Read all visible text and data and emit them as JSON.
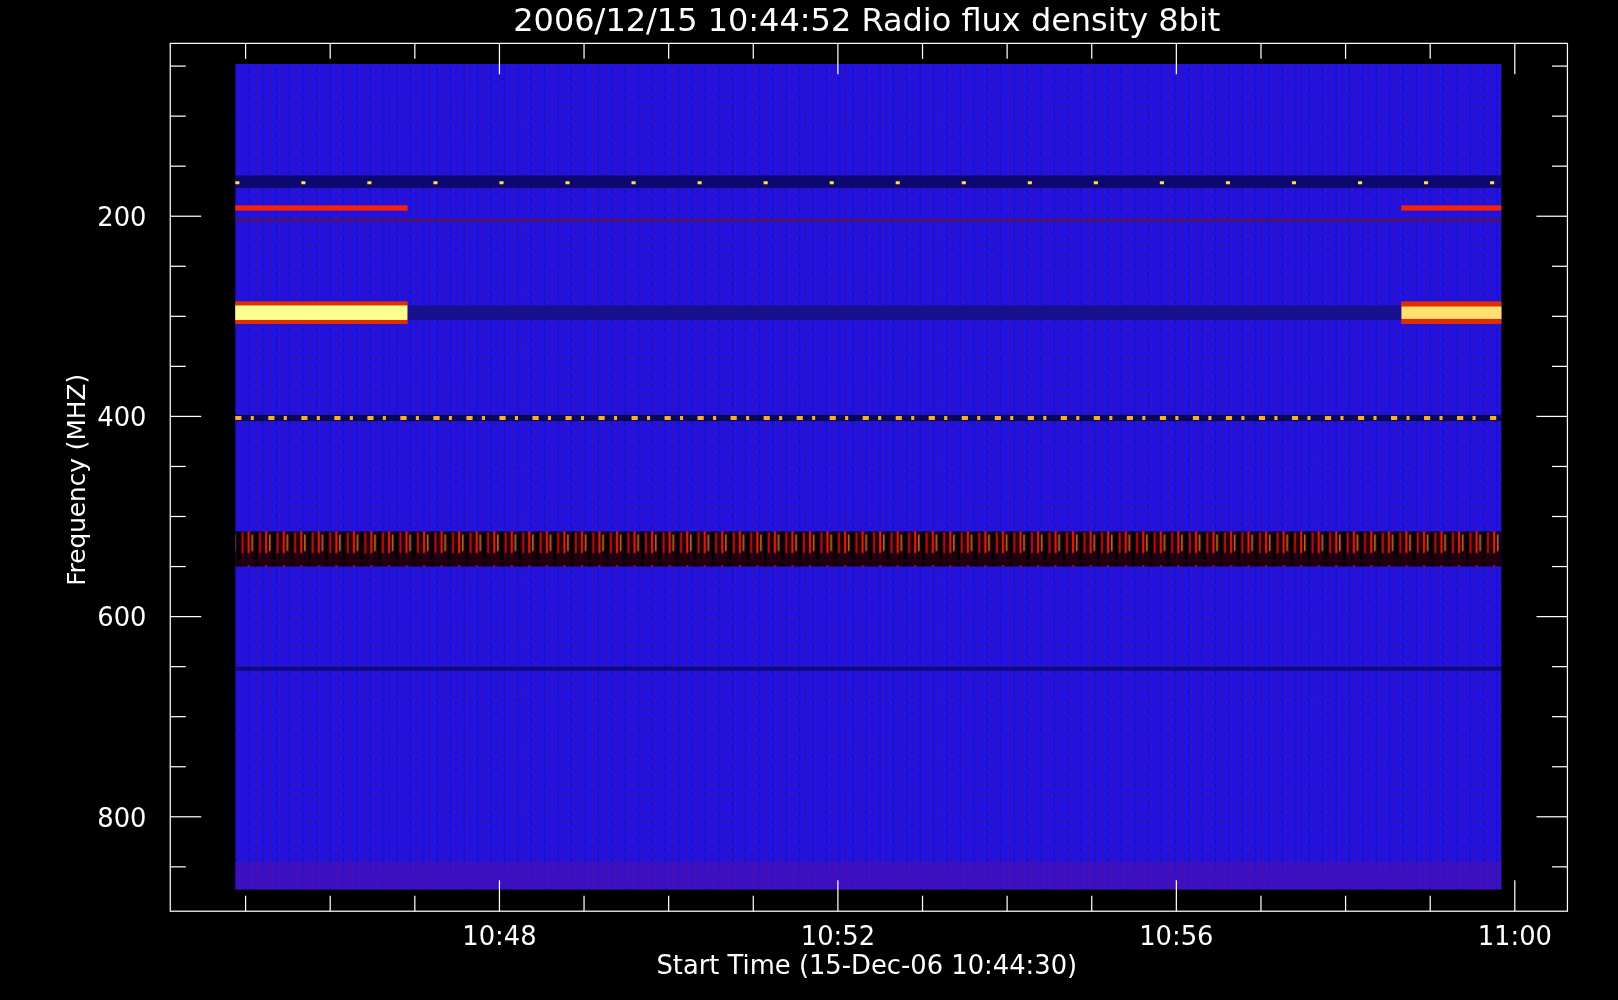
{
  "title": "2006/12/15 10:44:52 Radio flux density 8bit",
  "x_axis": {
    "label": "Start Time (15-Dec-06 10:44:30)",
    "ticks": [
      "10:48",
      "10:52",
      "10:56",
      "11:00"
    ]
  },
  "y_axis": {
    "label": "Frequency (MHZ)",
    "ticks": [
      "200",
      "400",
      "600",
      "800"
    ]
  }
}
